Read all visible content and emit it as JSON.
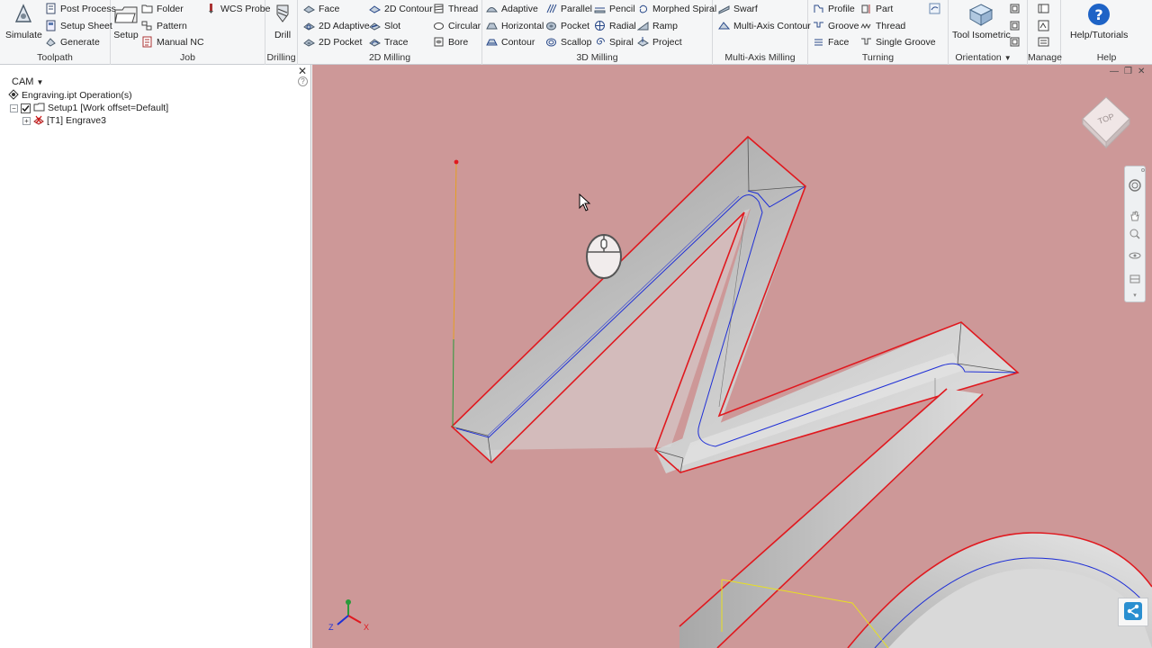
{
  "ribbon": {
    "toolpath": {
      "label": "Toolpath",
      "simulate": "Simulate",
      "post_process": "Post Process",
      "setup_sheet": "Setup Sheet",
      "generate": "Generate"
    },
    "job": {
      "label": "Job",
      "setup": "Setup",
      "folder": "Folder",
      "pattern": "Pattern",
      "manual_nc": "Manual NC",
      "wcs_probe": "WCS Probe"
    },
    "drilling": {
      "label": "Drilling",
      "drill": "Drill"
    },
    "milling2d": {
      "label": "2D Milling",
      "face": "Face",
      "adaptive2d": "2D Adaptive",
      "pocket2d": "2D Pocket",
      "contour2d": "2D Contour",
      "slot": "Slot",
      "trace": "Trace",
      "thread": "Thread",
      "circular": "Circular",
      "bore": "Bore"
    },
    "milling3d": {
      "label": "3D Milling",
      "adaptive": "Adaptive",
      "horizontal": "Horizontal",
      "contour": "Contour",
      "parallel": "Parallel",
      "pocket": "Pocket",
      "scallop": "Scallop",
      "pencil": "Pencil",
      "radial": "Radial",
      "spiral": "Spiral",
      "morphed_spiral": "Morphed Spiral",
      "ramp": "Ramp",
      "project": "Project"
    },
    "multiaxis": {
      "label": "Multi-Axis Milling",
      "swarf": "Swarf",
      "multi_axis_contour": "Multi-Axis Contour"
    },
    "turning": {
      "label": "Turning",
      "profile": "Profile",
      "groove": "Groove",
      "face": "Face",
      "part": "Part",
      "thread": "Thread",
      "single_groove": "Single Groove"
    },
    "orientation": {
      "label": "Orientation",
      "tool_isometric": "Tool Isometric"
    },
    "manage": {
      "label": "Manage"
    },
    "help": {
      "label": "Help",
      "help_tutorials": "Help/Tutorials"
    }
  },
  "panel": {
    "title": "CAM",
    "close": "✕",
    "help": "?",
    "tree": {
      "root": "Engraving.ipt Operation(s)",
      "setup": "Setup1 [Work offset=Default]",
      "operation": "[T1] Engrave3"
    }
  },
  "viewport": {
    "viewcube_label": "TOP",
    "axes": {
      "x": "X",
      "y": "Y",
      "z": "Z"
    },
    "window_controls": {
      "minimize": "—",
      "restore": "❐",
      "close": "✕"
    }
  },
  "colors": {
    "viewport_bg": "#cd9898",
    "outline": "#e0191f",
    "toolpath": "#1f2fd6",
    "ribbon_bg": "#f5f6f7"
  }
}
